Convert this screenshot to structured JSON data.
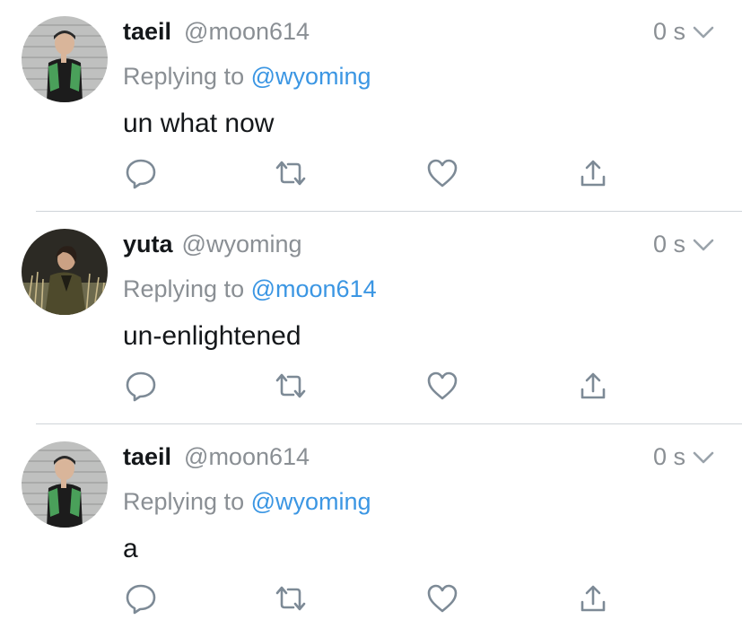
{
  "tweets": [
    {
      "display_name": "taeil",
      "handle": "@moon614",
      "timestamp": "0 s",
      "reply_prefix": "Replying to",
      "reply_to": "@wyoming",
      "text": "un what now",
      "avatar": "avatar-taeil"
    },
    {
      "display_name": "yuta",
      "handle": "@wyoming",
      "timestamp": "0 s",
      "reply_prefix": "Replying to",
      "reply_to": "@moon614",
      "text": "un-enlightened",
      "avatar": "avatar-yuta"
    },
    {
      "display_name": "taeil",
      "handle": "@moon614",
      "timestamp": "0 s",
      "reply_prefix": "Replying to",
      "reply_to": "@wyoming",
      "text": "a",
      "avatar": "avatar-taeil"
    }
  ],
  "icons": {
    "reply": "reply-icon",
    "retweet": "retweet-icon",
    "like": "heart-icon",
    "share": "share-icon",
    "more": "chevron-down-icon"
  },
  "colors": {
    "text": "#14171a",
    "secondary": "#8a8f94",
    "link": "#3b96e3",
    "icon": "#7d8a96",
    "divider": "#cfd4d8"
  }
}
